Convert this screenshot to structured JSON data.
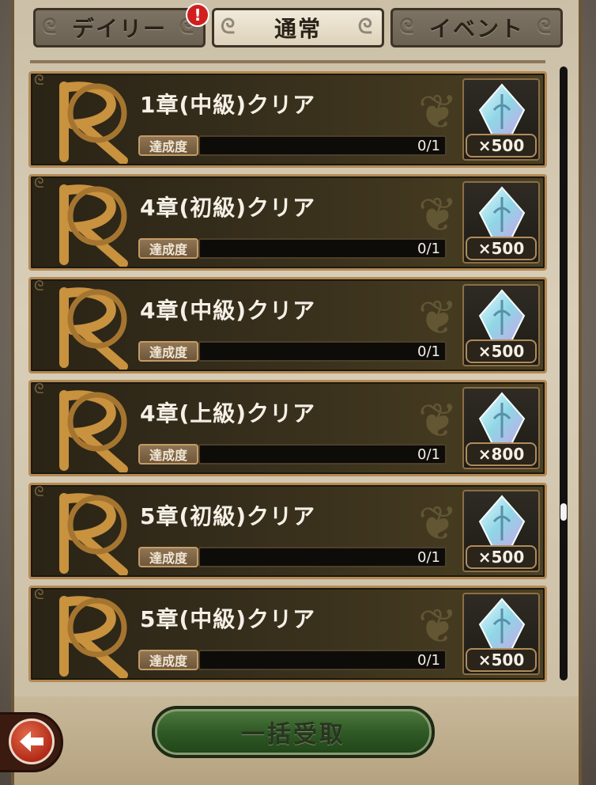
{
  "tabs": [
    {
      "label": "デイリー",
      "active": false,
      "alert": "!"
    },
    {
      "label": "通常",
      "active": true
    },
    {
      "label": "イベント",
      "active": false
    }
  ],
  "missions": [
    {
      "title": "1章(中級)クリア",
      "progress_label": "達成度",
      "progress": "0/1",
      "progress_fraction": 0,
      "reward_qty": "×500"
    },
    {
      "title": "4章(初級)クリア",
      "progress_label": "達成度",
      "progress": "0/1",
      "progress_fraction": 0,
      "reward_qty": "×500"
    },
    {
      "title": "4章(中級)クリア",
      "progress_label": "達成度",
      "progress": "0/1",
      "progress_fraction": 0,
      "reward_qty": "×500"
    },
    {
      "title": "4章(上級)クリア",
      "progress_label": "達成度",
      "progress": "0/1",
      "progress_fraction": 0,
      "reward_qty": "×800"
    },
    {
      "title": "5章(初級)クリア",
      "progress_label": "達成度",
      "progress": "0/1",
      "progress_fraction": 0,
      "reward_qty": "×500"
    },
    {
      "title": "5章(中級)クリア",
      "progress_label": "達成度",
      "progress": "0/1",
      "progress_fraction": 0,
      "reward_qty": "×500"
    }
  ],
  "claim_all_label": "一括受取",
  "back_icon": "back-arrow-icon",
  "colors": {
    "card_border": "#b48a54",
    "claim_button": "#2f5a26",
    "alert": "#d11f1f"
  }
}
